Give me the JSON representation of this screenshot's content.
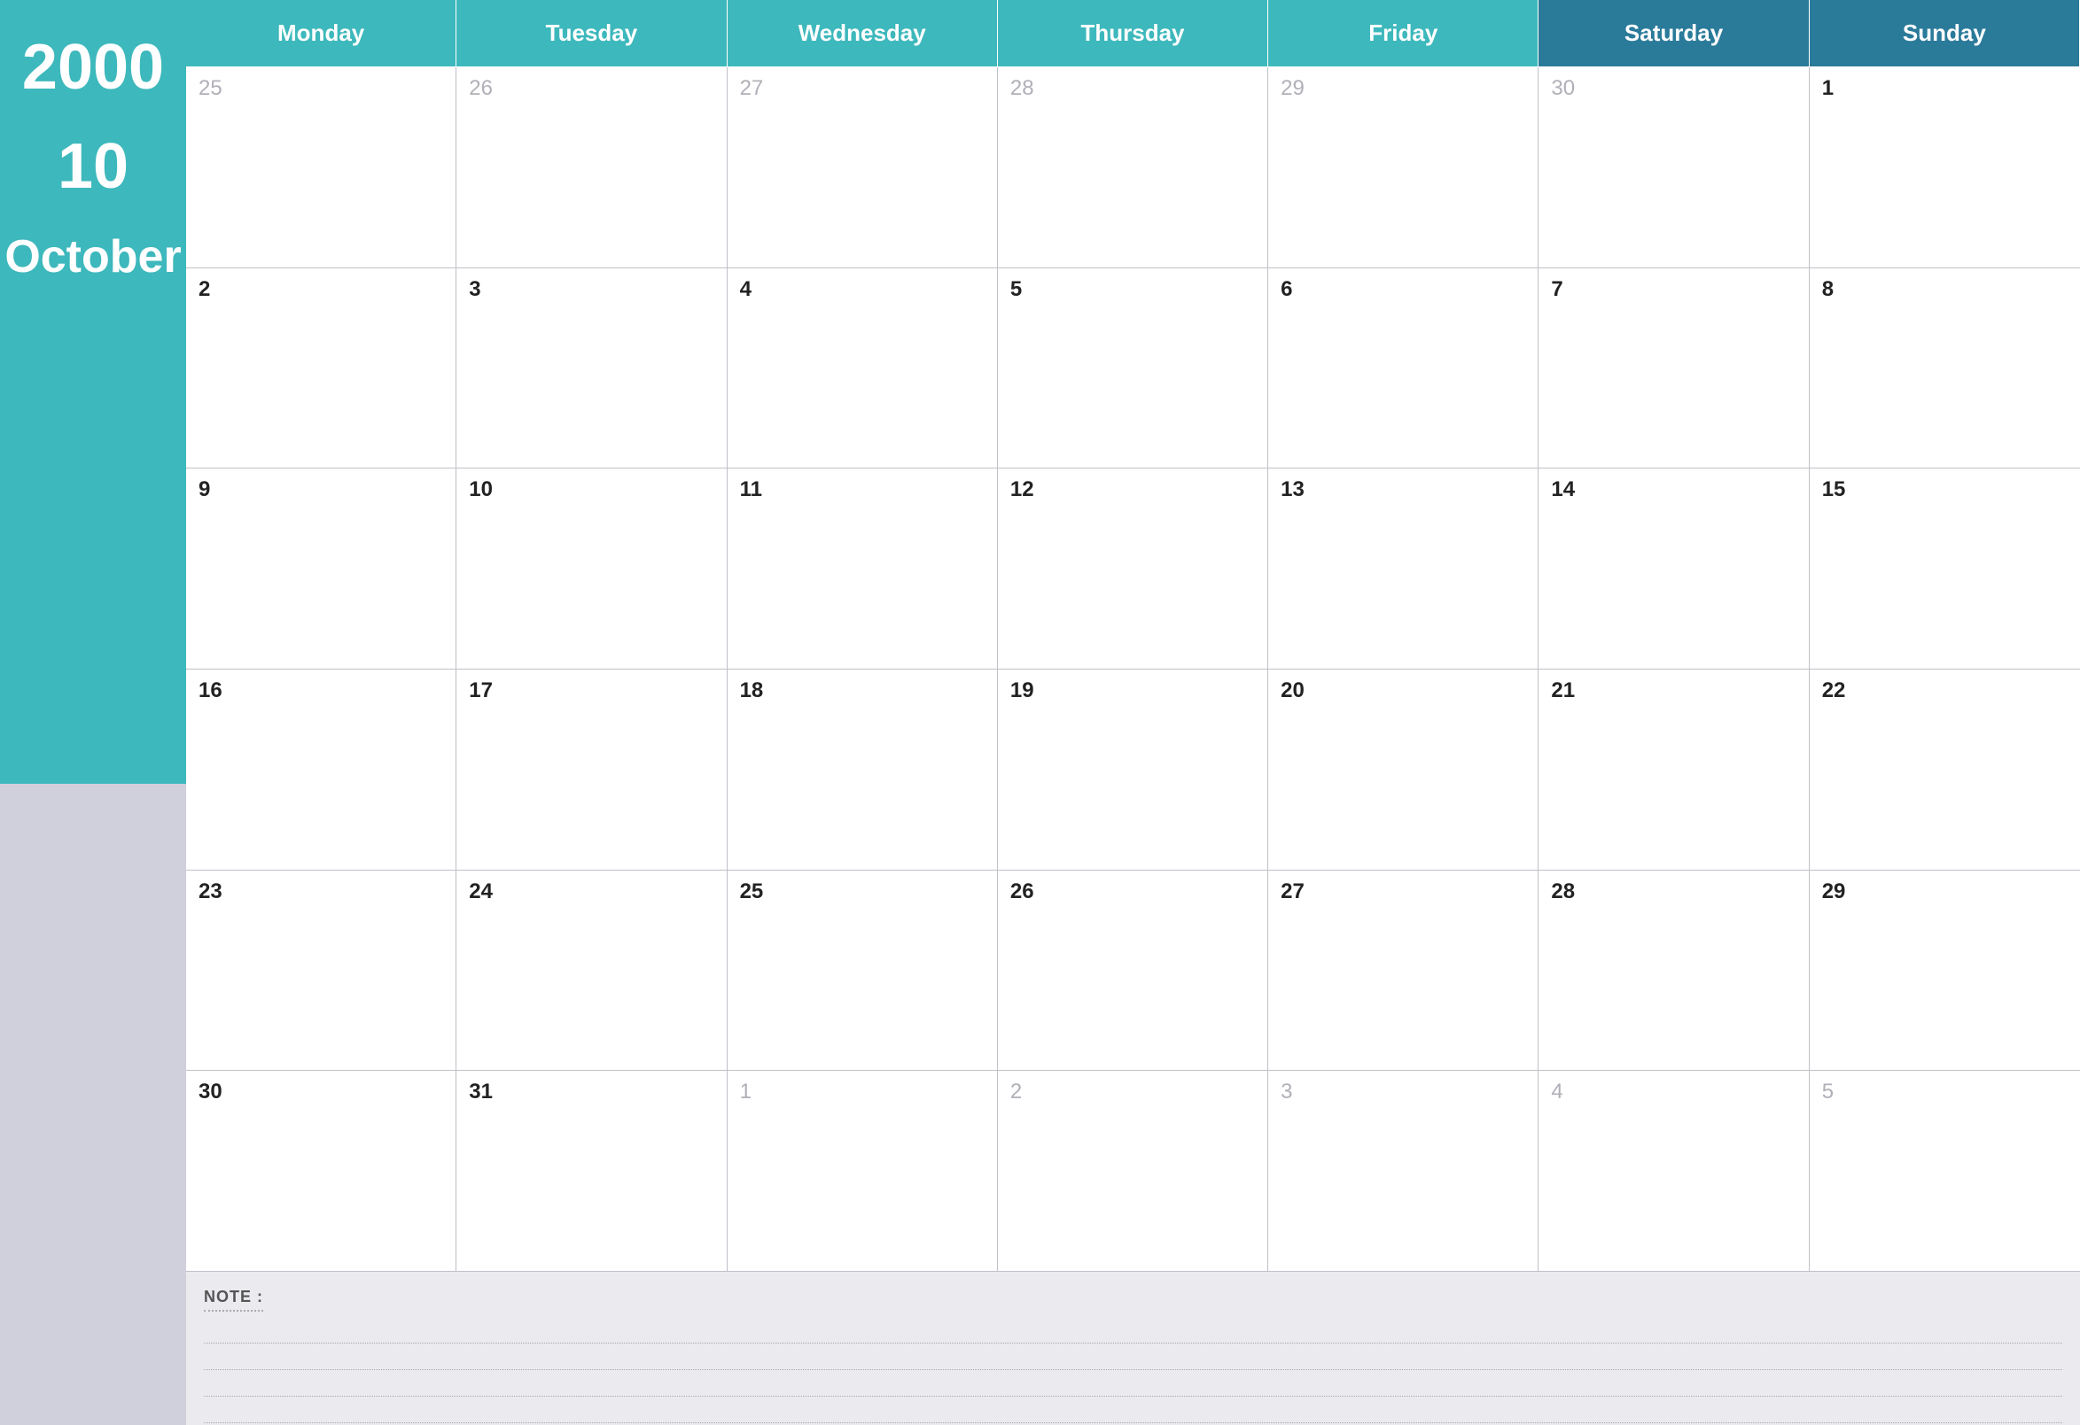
{
  "sidebar": {
    "year": "2000",
    "month_num": "10",
    "month_name": "October"
  },
  "header": {
    "days": [
      {
        "label": "Monday",
        "dark": false
      },
      {
        "label": "Tuesday",
        "dark": false
      },
      {
        "label": "Wednesday",
        "dark": false
      },
      {
        "label": "Thursday",
        "dark": false
      },
      {
        "label": "Friday",
        "dark": false
      },
      {
        "label": "Saturday",
        "dark": true
      },
      {
        "label": "Sunday",
        "dark": true
      }
    ]
  },
  "weeks": [
    [
      {
        "num": "25",
        "other": true
      },
      {
        "num": "26",
        "other": true
      },
      {
        "num": "27",
        "other": true
      },
      {
        "num": "28",
        "other": true
      },
      {
        "num": "29",
        "other": true
      },
      {
        "num": "30",
        "other": true
      },
      {
        "num": "1",
        "other": false
      }
    ],
    [
      {
        "num": "2",
        "other": false
      },
      {
        "num": "3",
        "other": false
      },
      {
        "num": "4",
        "other": false
      },
      {
        "num": "5",
        "other": false
      },
      {
        "num": "6",
        "other": false
      },
      {
        "num": "7",
        "other": false
      },
      {
        "num": "8",
        "other": false
      }
    ],
    [
      {
        "num": "9",
        "other": false
      },
      {
        "num": "10",
        "other": false
      },
      {
        "num": "11",
        "other": false
      },
      {
        "num": "12",
        "other": false
      },
      {
        "num": "13",
        "other": false
      },
      {
        "num": "14",
        "other": false
      },
      {
        "num": "15",
        "other": false
      }
    ],
    [
      {
        "num": "16",
        "other": false
      },
      {
        "num": "17",
        "other": false
      },
      {
        "num": "18",
        "other": false
      },
      {
        "num": "19",
        "other": false
      },
      {
        "num": "20",
        "other": false
      },
      {
        "num": "21",
        "other": false
      },
      {
        "num": "22",
        "other": false
      }
    ],
    [
      {
        "num": "23",
        "other": false
      },
      {
        "num": "24",
        "other": false
      },
      {
        "num": "25",
        "other": false
      },
      {
        "num": "26",
        "other": false
      },
      {
        "num": "27",
        "other": false
      },
      {
        "num": "28",
        "other": false
      },
      {
        "num": "29",
        "other": false
      }
    ],
    [
      {
        "num": "30",
        "other": false
      },
      {
        "num": "31",
        "other": false
      },
      {
        "num": "1",
        "other": true
      },
      {
        "num": "2",
        "other": true
      },
      {
        "num": "3",
        "other": true
      },
      {
        "num": "4",
        "other": true
      },
      {
        "num": "5",
        "other": true
      }
    ]
  ],
  "notes": {
    "label": "NOTE :",
    "lines": 4
  }
}
